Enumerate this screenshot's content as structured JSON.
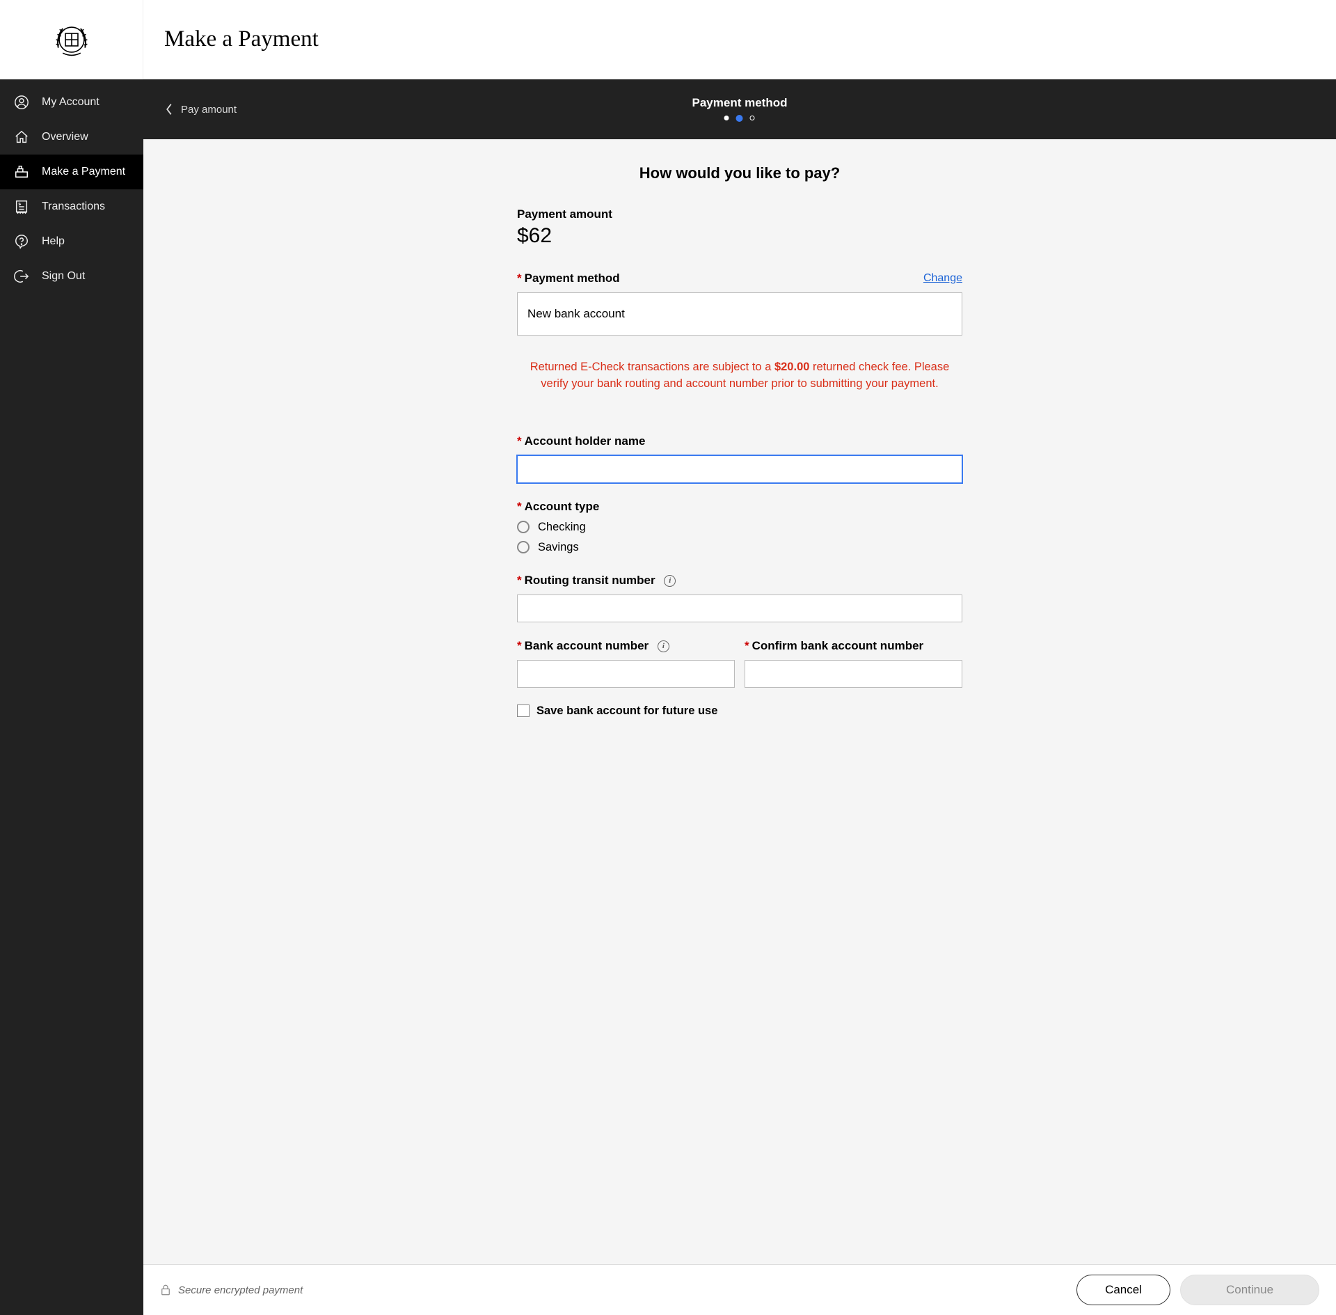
{
  "header": {
    "title": "Make a Payment"
  },
  "sidebar": {
    "items": [
      {
        "label": "My Account"
      },
      {
        "label": "Overview"
      },
      {
        "label": "Make a Payment"
      },
      {
        "label": "Transactions"
      },
      {
        "label": "Help"
      },
      {
        "label": "Sign Out"
      }
    ]
  },
  "stepper": {
    "back_label": "Pay amount",
    "current_step_label": "Payment method"
  },
  "main": {
    "question": "How would you like to pay?",
    "payment_amount_label": "Payment amount",
    "payment_amount_value": "$62",
    "payment_method": {
      "label": "Payment method",
      "change_label": "Change",
      "selected": "New bank account"
    },
    "warning": {
      "prefix": "Returned E-Check transactions are subject to a ",
      "fee": "$20.00",
      "suffix": " returned check fee.  Please verify your bank routing and account number prior to submitting your payment."
    },
    "fields": {
      "account_holder_label": "Account holder name",
      "account_holder_value": "",
      "account_holder_placeholder": "|",
      "account_type_label": "Account type",
      "account_type_options": {
        "checking": "Checking",
        "savings": "Savings"
      },
      "routing_label": "Routing transit number",
      "routing_value": "",
      "bank_account_label": "Bank account number",
      "bank_account_value": "",
      "confirm_bank_label": "Confirm bank account number",
      "confirm_bank_value": "",
      "save_checkbox_label": "Save bank account for future use"
    }
  },
  "footer": {
    "secure_label": "Secure encrypted payment",
    "cancel_label": "Cancel",
    "continue_label": "Continue"
  }
}
